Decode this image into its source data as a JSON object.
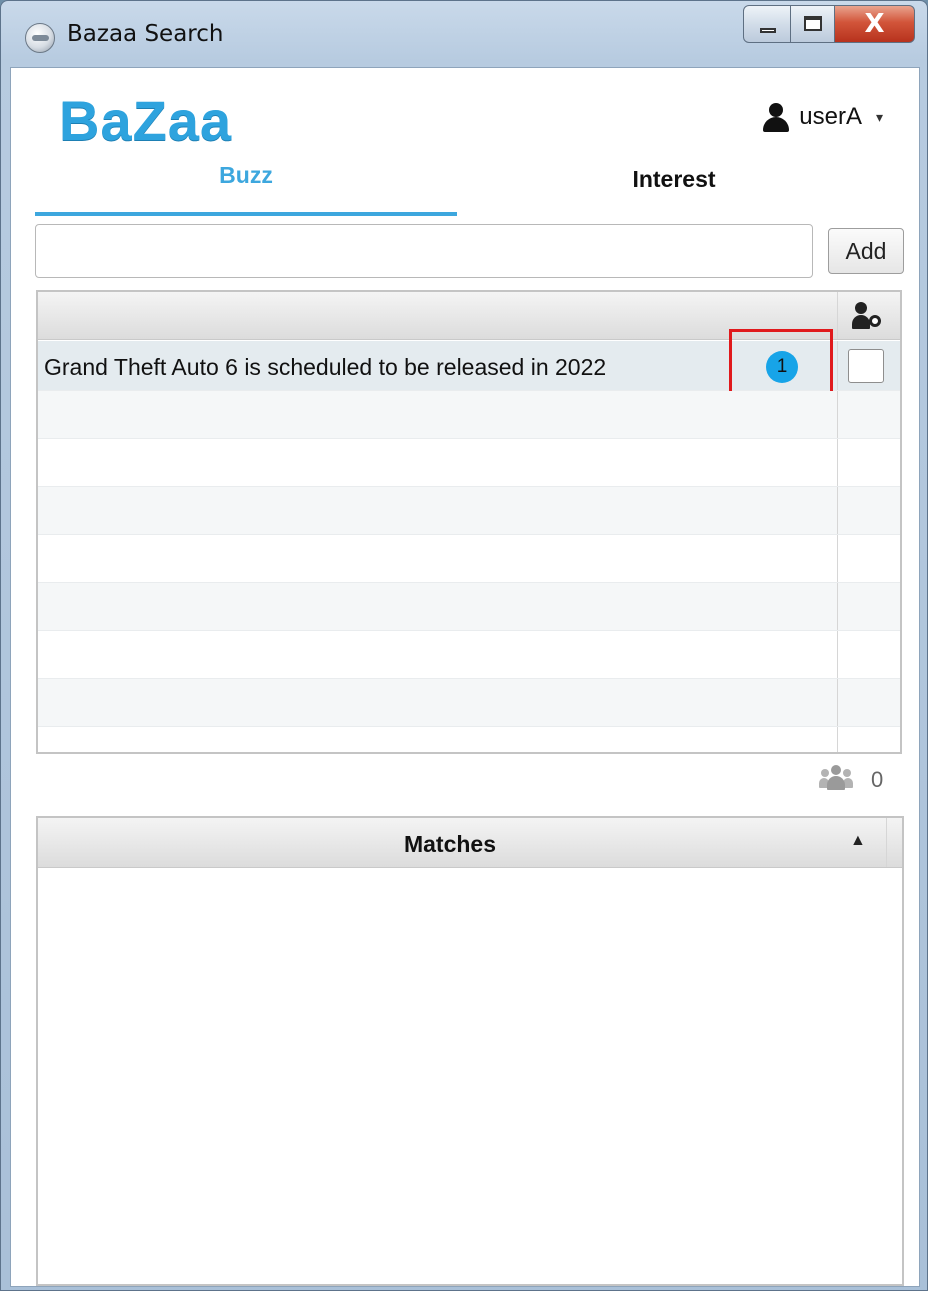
{
  "window": {
    "title": "Bazaa Search",
    "close_glyph": "X"
  },
  "header": {
    "logo": "BaZaa",
    "user": "userA",
    "user_menu_caret": "▾"
  },
  "tabs": [
    {
      "label": "Buzz",
      "active": true
    },
    {
      "label": "Interest",
      "active": false
    }
  ],
  "input": {
    "value": "",
    "placeholder": "",
    "add_label": "Add"
  },
  "buzz_table": {
    "rows": [
      {
        "text": "Grand Theft Auto 6 is scheduled to be released in 2022",
        "count": "1",
        "checked": false
      }
    ]
  },
  "participants": {
    "count": "0"
  },
  "matches": {
    "title": "Matches",
    "sort_glyph": "▲"
  },
  "colors": {
    "accent": "#2ea3de",
    "badge": "#17a4e8",
    "highlight": "#e0191c"
  },
  "icons": [
    "app-icon",
    "minimize-icon",
    "maximize-icon",
    "close-icon",
    "user-icon",
    "chevron-down-icon",
    "user-settings-icon",
    "group-icon",
    "sort-up-icon"
  ]
}
